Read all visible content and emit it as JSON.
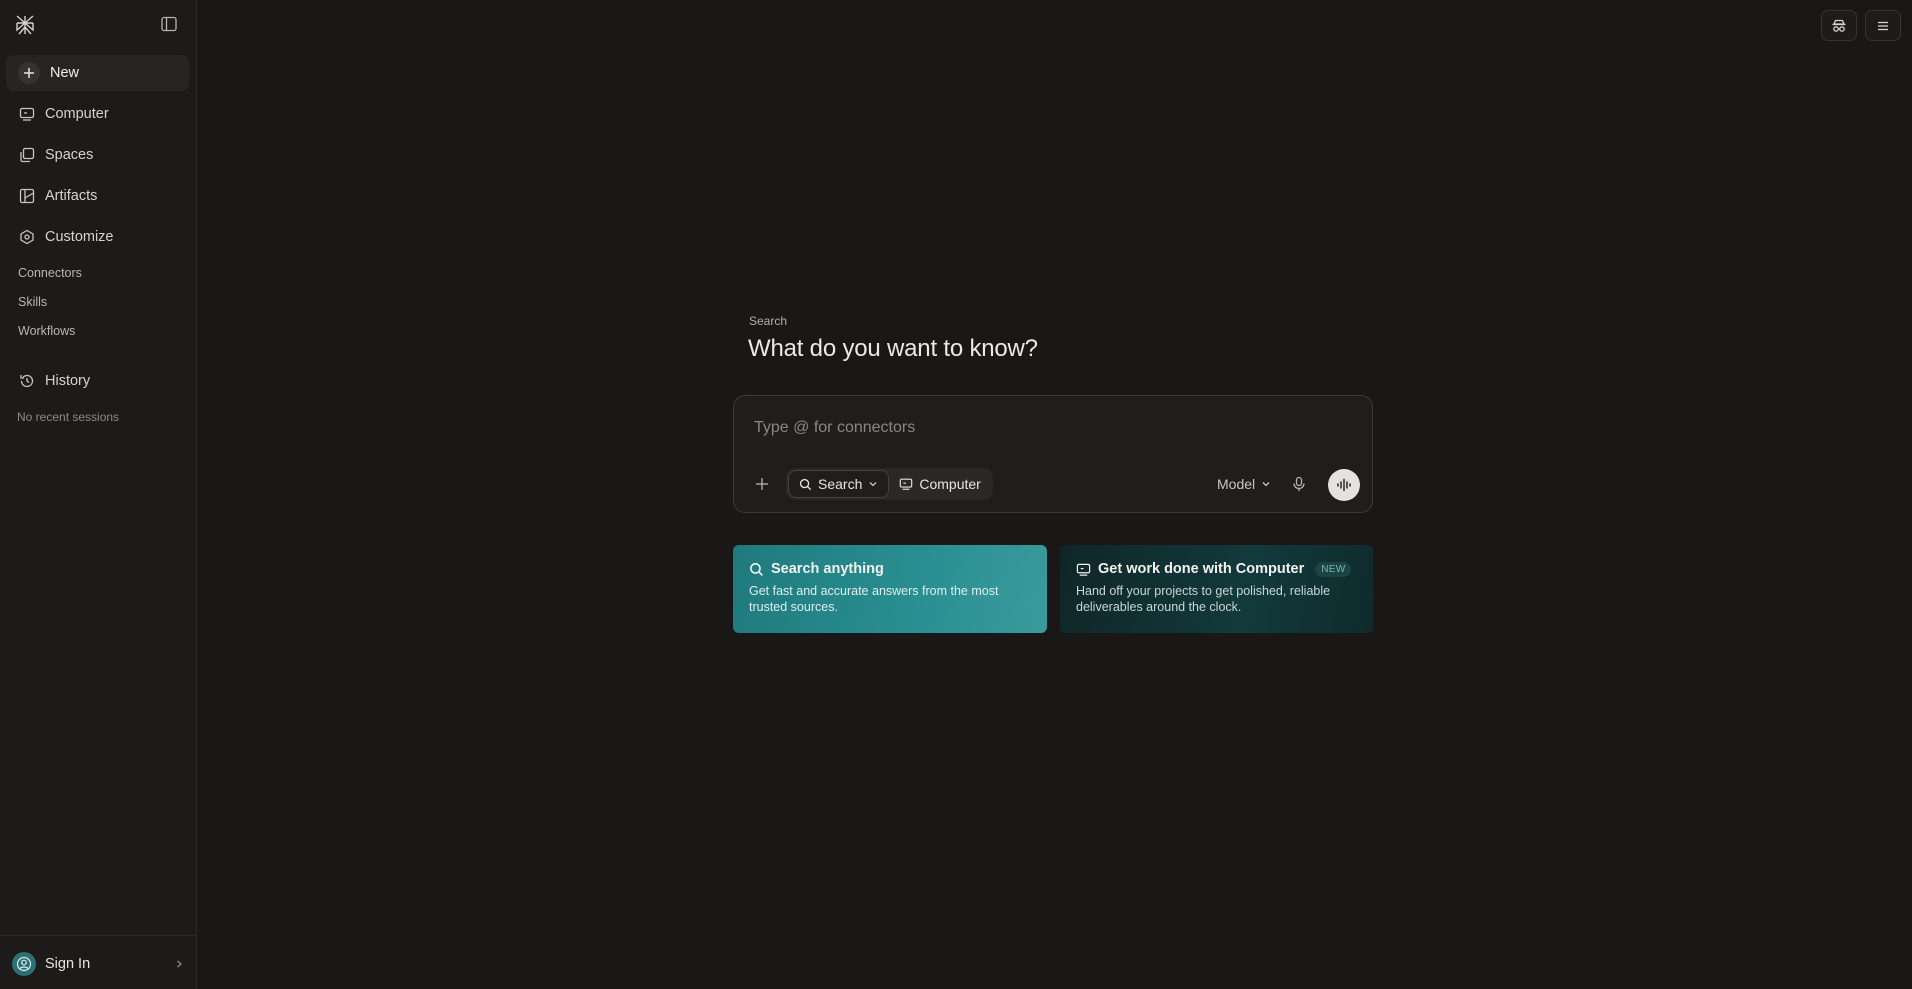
{
  "sidebar": {
    "nav": [
      {
        "label": "New",
        "icon": "plus-icon"
      },
      {
        "label": "Computer",
        "icon": "computer-icon"
      },
      {
        "label": "Spaces",
        "icon": "spaces-icon"
      },
      {
        "label": "Artifacts",
        "icon": "artifacts-icon"
      },
      {
        "label": "Customize",
        "icon": "customize-icon"
      }
    ],
    "sub_items": [
      "Connectors",
      "Skills",
      "Workflows"
    ],
    "history_label": "History",
    "no_recent": "No recent sessions",
    "signin_label": "Sign In"
  },
  "main": {
    "hero_label": "Search",
    "hero_title": "What do you want to know?",
    "composer": {
      "placeholder": "Type @ for connectors",
      "modes": [
        "Search",
        "Computer"
      ],
      "model_label": "Model"
    },
    "cards": [
      {
        "title": "Search anything",
        "desc": "Get fast and accurate answers from the most trusted sources.",
        "icon": "search-icon"
      },
      {
        "title": "Get work done with Computer",
        "badge": "NEW",
        "desc": "Hand off your projects to get polished, reliable deliverables around the clock.",
        "icon": "computer-icon"
      }
    ]
  },
  "colors": {
    "background": "#191817",
    "accent_teal": "#2a8f92"
  }
}
